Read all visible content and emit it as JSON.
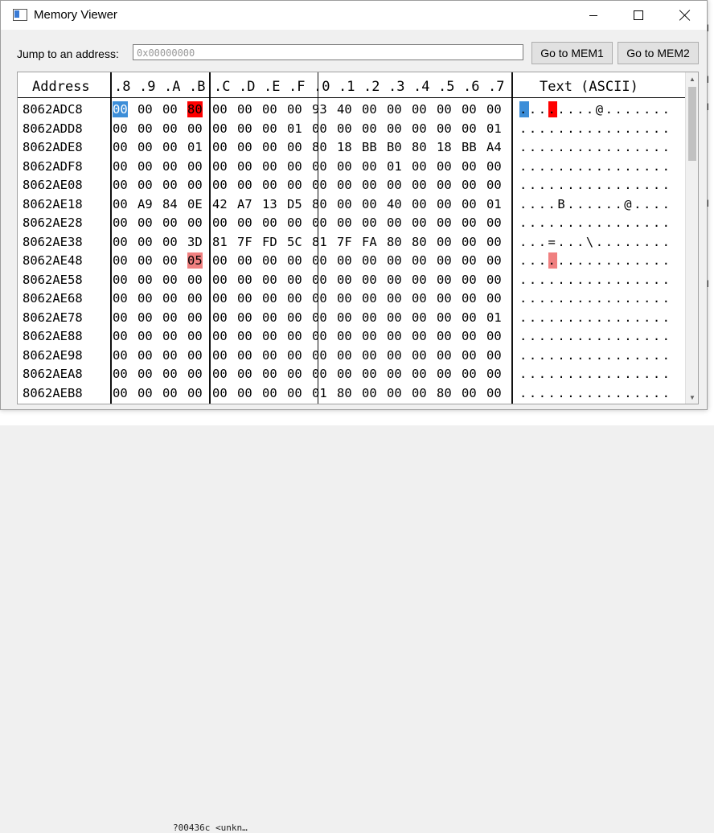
{
  "window": {
    "title": "Memory Viewer"
  },
  "jump": {
    "label": "Jump to an address:",
    "value": "0x00000000"
  },
  "buttons": {
    "mem1": "Go to MEM1",
    "mem2": "Go to MEM2"
  },
  "background": {
    "bottom_text": "?00436c <unkn…",
    "right_chars": [
      "l",
      "l",
      "l",
      "l",
      "l"
    ]
  },
  "hex": {
    "address_header": "Address",
    "column_headers": [
      ".8",
      ".9",
      ".A",
      ".B",
      ".C",
      ".D",
      ".E",
      ".F",
      ".0",
      ".1",
      ".2",
      ".3",
      ".4",
      ".5",
      ".6",
      ".7"
    ],
    "ascii_header": "Text (ASCII)",
    "rows": [
      {
        "addr": "8062ADC8",
        "bytes": [
          "00",
          "00",
          "00",
          "80",
          "00",
          "00",
          "00",
          "00",
          "93",
          "40",
          "00",
          "00",
          "00",
          "00",
          "00",
          "00"
        ],
        "ascii": "........@......."
      },
      {
        "addr": "8062ADD8",
        "bytes": [
          "00",
          "00",
          "00",
          "00",
          "00",
          "00",
          "00",
          "01",
          "00",
          "00",
          "00",
          "00",
          "00",
          "00",
          "00",
          "01"
        ],
        "ascii": "................"
      },
      {
        "addr": "8062ADE8",
        "bytes": [
          "00",
          "00",
          "00",
          "01",
          "00",
          "00",
          "00",
          "00",
          "80",
          "18",
          "BB",
          "B0",
          "80",
          "18",
          "BB",
          "A4"
        ],
        "ascii": "................"
      },
      {
        "addr": "8062ADF8",
        "bytes": [
          "00",
          "00",
          "00",
          "00",
          "00",
          "00",
          "00",
          "00",
          "00",
          "00",
          "00",
          "01",
          "00",
          "00",
          "00",
          "00"
        ],
        "ascii": "................"
      },
      {
        "addr": "8062AE08",
        "bytes": [
          "00",
          "00",
          "00",
          "00",
          "00",
          "00",
          "00",
          "00",
          "00",
          "00",
          "00",
          "00",
          "00",
          "00",
          "00",
          "00"
        ],
        "ascii": "................"
      },
      {
        "addr": "8062AE18",
        "bytes": [
          "00",
          "A9",
          "84",
          "0E",
          "42",
          "A7",
          "13",
          "D5",
          "80",
          "00",
          "00",
          "40",
          "00",
          "00",
          "00",
          "01"
        ],
        "ascii": "....B......@...."
      },
      {
        "addr": "8062AE28",
        "bytes": [
          "00",
          "00",
          "00",
          "00",
          "00",
          "00",
          "00",
          "00",
          "00",
          "00",
          "00",
          "00",
          "00",
          "00",
          "00",
          "00"
        ],
        "ascii": "................"
      },
      {
        "addr": "8062AE38",
        "bytes": [
          "00",
          "00",
          "00",
          "3D",
          "81",
          "7F",
          "FD",
          "5C",
          "81",
          "7F",
          "FA",
          "80",
          "80",
          "00",
          "00",
          "00"
        ],
        "ascii": "...=...\\........"
      },
      {
        "addr": "8062AE48",
        "bytes": [
          "00",
          "00",
          "00",
          "05",
          "00",
          "00",
          "00",
          "00",
          "00",
          "00",
          "00",
          "00",
          "00",
          "00",
          "00",
          "00"
        ],
        "ascii": "................"
      },
      {
        "addr": "8062AE58",
        "bytes": [
          "00",
          "00",
          "00",
          "00",
          "00",
          "00",
          "00",
          "00",
          "00",
          "00",
          "00",
          "00",
          "00",
          "00",
          "00",
          "00"
        ],
        "ascii": "................"
      },
      {
        "addr": "8062AE68",
        "bytes": [
          "00",
          "00",
          "00",
          "00",
          "00",
          "00",
          "00",
          "00",
          "00",
          "00",
          "00",
          "00",
          "00",
          "00",
          "00",
          "00"
        ],
        "ascii": "................"
      },
      {
        "addr": "8062AE78",
        "bytes": [
          "00",
          "00",
          "00",
          "00",
          "00",
          "00",
          "00",
          "00",
          "00",
          "00",
          "00",
          "00",
          "00",
          "00",
          "00",
          "01"
        ],
        "ascii": "................"
      },
      {
        "addr": "8062AE88",
        "bytes": [
          "00",
          "00",
          "00",
          "00",
          "00",
          "00",
          "00",
          "00",
          "00",
          "00",
          "00",
          "00",
          "00",
          "00",
          "00",
          "00"
        ],
        "ascii": "................"
      },
      {
        "addr": "8062AE98",
        "bytes": [
          "00",
          "00",
          "00",
          "00",
          "00",
          "00",
          "00",
          "00",
          "00",
          "00",
          "00",
          "00",
          "00",
          "00",
          "00",
          "00"
        ],
        "ascii": "................"
      },
      {
        "addr": "8062AEA8",
        "bytes": [
          "00",
          "00",
          "00",
          "00",
          "00",
          "00",
          "00",
          "00",
          "00",
          "00",
          "00",
          "00",
          "00",
          "00",
          "00",
          "00"
        ],
        "ascii": "................"
      },
      {
        "addr": "8062AEB8",
        "bytes": [
          "00",
          "00",
          "00",
          "00",
          "00",
          "00",
          "00",
          "00",
          "01",
          "80",
          "00",
          "00",
          "00",
          "80",
          "00",
          "00"
        ],
        "ascii": "................"
      }
    ],
    "highlights": [
      {
        "row": 0,
        "col": 0,
        "color": "#3d8ed8"
      },
      {
        "row": 0,
        "col": 3,
        "color": "#ff0000"
      },
      {
        "row": 8,
        "col": 3,
        "color": "#f08080"
      }
    ]
  }
}
